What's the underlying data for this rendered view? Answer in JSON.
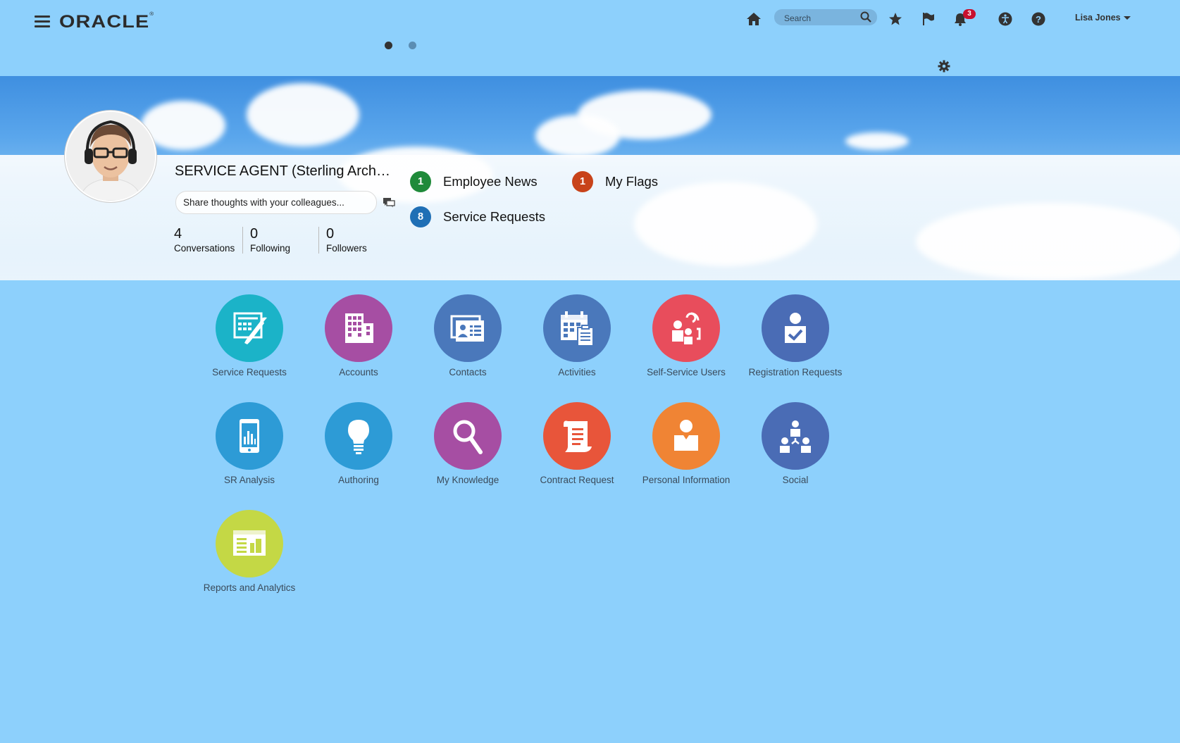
{
  "header": {
    "logo_text": "ORACLE",
    "search_placeholder": "Search",
    "notifications_count": "3",
    "user_name": "Lisa Jones"
  },
  "profile": {
    "title": "SERVICE AGENT (Sterling Arch…",
    "share_placeholder": "Share thoughts with your colleagues...",
    "stats": [
      {
        "value": "4",
        "label": "Conversations"
      },
      {
        "value": "0",
        "label": "Following"
      },
      {
        "value": "0",
        "label": "Followers"
      }
    ]
  },
  "notifications": [
    {
      "count": "1",
      "label": "Employee News",
      "color": "#1f8a3a"
    },
    {
      "count": "1",
      "label": "My Flags",
      "color": "#c8431a"
    },
    {
      "count": "8",
      "label": "Service Requests",
      "color": "#1f6fb5"
    }
  ],
  "tiles": [
    {
      "label": "Service Requests",
      "color": "#1bb3c8",
      "icon": "service-requests-icon"
    },
    {
      "label": "Accounts",
      "color": "#a64ea3",
      "icon": "accounts-icon"
    },
    {
      "label": "Contacts",
      "color": "#4a78bb",
      "icon": "contacts-icon"
    },
    {
      "label": "Activities",
      "color": "#4a78bb",
      "icon": "activities-icon"
    },
    {
      "label": "Self-Service Users",
      "color": "#e84d5c",
      "icon": "self-service-users-icon"
    },
    {
      "label": "Registration Requests",
      "color": "#4a6cb5",
      "icon": "registration-requests-icon"
    },
    {
      "label": "SR Analysis",
      "color": "#2d9bd6",
      "icon": "sr-analysis-icon"
    },
    {
      "label": "Authoring",
      "color": "#2d9bd6",
      "icon": "authoring-icon"
    },
    {
      "label": "My Knowledge",
      "color": "#a64ea3",
      "icon": "my-knowledge-icon"
    },
    {
      "label": "Contract Request",
      "color": "#e8553a",
      "icon": "contract-request-icon"
    },
    {
      "label": "Personal Information",
      "color": "#f08434",
      "icon": "personal-information-icon"
    },
    {
      "label": "Social",
      "color": "#4a6cb5",
      "icon": "social-icon"
    },
    {
      "label": "Reports and Analytics",
      "color": "#c4d845",
      "icon": "reports-analytics-icon"
    }
  ]
}
